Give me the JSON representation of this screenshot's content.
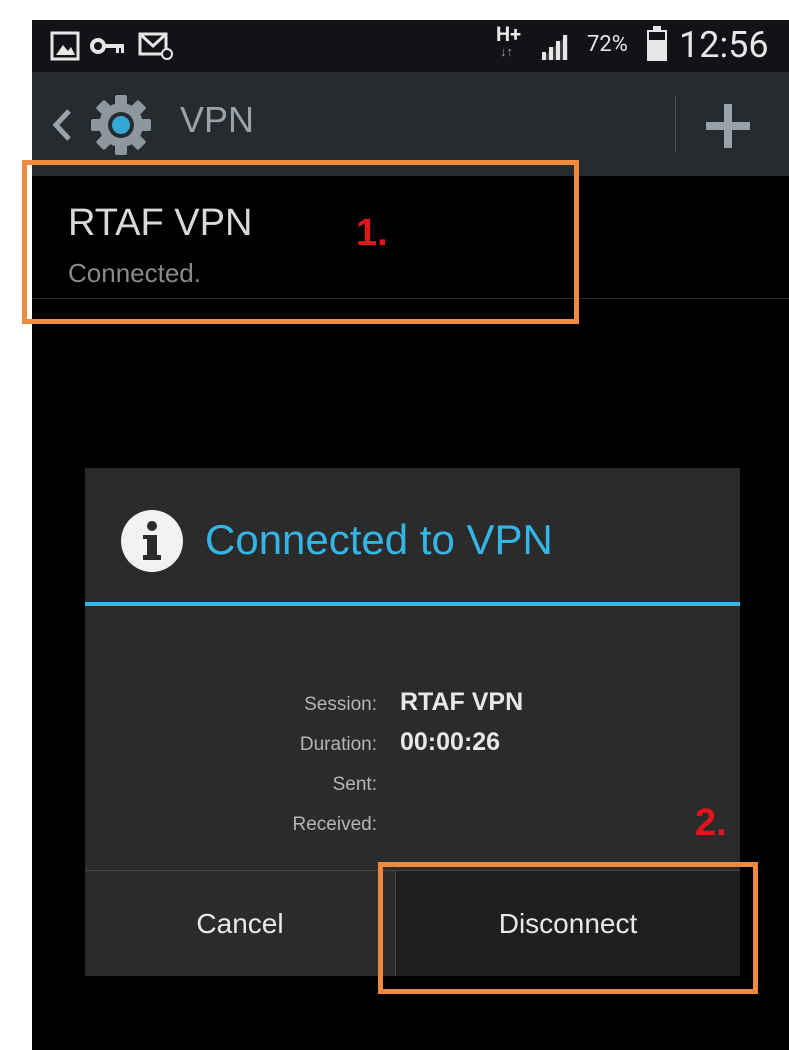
{
  "status_bar": {
    "network": "H+",
    "network_sub": "↓↑",
    "battery": "72%",
    "time": "12:56"
  },
  "action_bar": {
    "title": "VPN",
    "add_label": "+"
  },
  "vpn_list": [
    {
      "name": "RTAF VPN",
      "status": "Connected."
    }
  ],
  "dialog": {
    "title": "Connected to VPN",
    "fields": [
      {
        "label": "Session:",
        "value": "RTAF VPN"
      },
      {
        "label": "Duration:",
        "value": "00:00:26"
      },
      {
        "label": "Sent:",
        "value": ""
      },
      {
        "label": "Received:",
        "value": ""
      }
    ],
    "cancel_label": "Cancel",
    "disconnect_label": "Disconnect"
  },
  "annotations": {
    "step1": "1.",
    "step2": "2."
  },
  "colors": {
    "accent": "#33b5e5",
    "annotation_box": "#f08a3c",
    "annotation_text": "#e5141b"
  },
  "icons": {
    "status_bar": [
      "gallery-icon",
      "vpn-key-icon",
      "email-icon",
      "signal-icon",
      "battery-icon"
    ],
    "action_bar": [
      "back-chevron-icon",
      "settings-gear-icon",
      "add-icon"
    ],
    "dialog": [
      "info-icon"
    ]
  }
}
